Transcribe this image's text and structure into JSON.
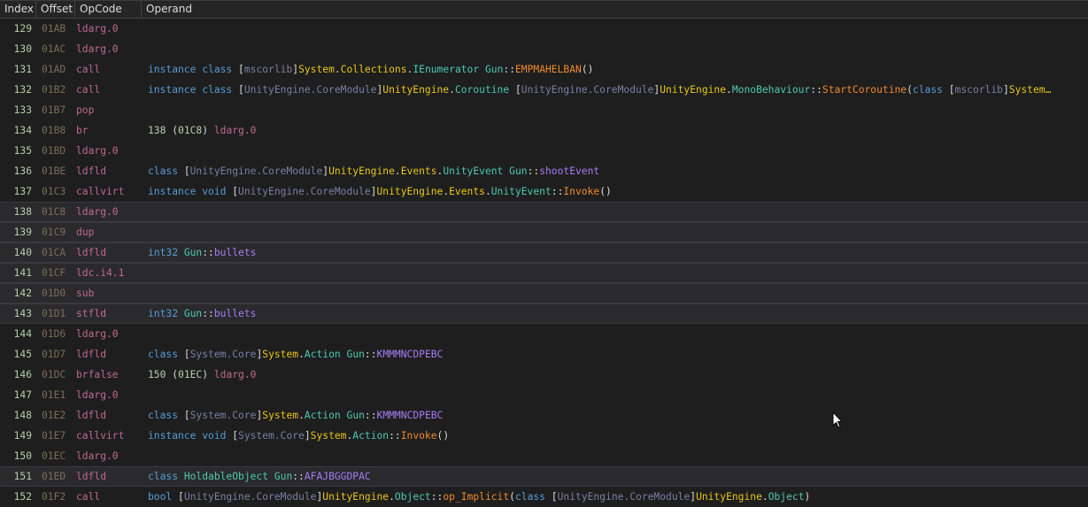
{
  "header": {
    "columns": [
      "Index",
      "Offset",
      "OpCode",
      "Operand"
    ]
  },
  "colors": {
    "keyword": "#569cd6",
    "assembly": "#7a7fa6",
    "namespace": "#e6c619",
    "type": "#4ec9b0",
    "method": "#f08a2c",
    "field": "#a77cf4",
    "opcode": "#c06a8e",
    "index": "#b5cea8",
    "offset": "#7a6e55",
    "background": "#1e1e1e",
    "selected_background": "#2a2a2d"
  },
  "rows": [
    {
      "index": "129",
      "offset": "01AB",
      "opcode": "ldarg.0",
      "selected": false,
      "operand": []
    },
    {
      "index": "130",
      "offset": "01AC",
      "opcode": "ldarg.0",
      "selected": false,
      "operand": []
    },
    {
      "index": "131",
      "offset": "01AD",
      "opcode": "call",
      "selected": false,
      "operand": [
        [
          "k",
          "instance class "
        ],
        [
          "p",
          "["
        ],
        [
          "a",
          "mscorlib"
        ],
        [
          "p",
          "]"
        ],
        [
          "n",
          "System"
        ],
        [
          "p",
          "."
        ],
        [
          "n",
          "Collections"
        ],
        [
          "p",
          "."
        ],
        [
          "t",
          "IEnumerator"
        ],
        [
          "p",
          " "
        ],
        [
          "t",
          "Gun"
        ],
        [
          "p",
          "::"
        ],
        [
          "m",
          "EMPMAHELBAN"
        ],
        [
          "p",
          "()"
        ]
      ]
    },
    {
      "index": "132",
      "offset": "01B2",
      "opcode": "call",
      "selected": false,
      "operand": [
        [
          "k",
          "instance class "
        ],
        [
          "p",
          "["
        ],
        [
          "a",
          "UnityEngine.CoreModule"
        ],
        [
          "p",
          "]"
        ],
        [
          "n",
          "UnityEngine"
        ],
        [
          "p",
          "."
        ],
        [
          "t",
          "Coroutine"
        ],
        [
          "p",
          " ["
        ],
        [
          "a",
          "UnityEngine.CoreModule"
        ],
        [
          "p",
          "]"
        ],
        [
          "n",
          "UnityEngine"
        ],
        [
          "p",
          "."
        ],
        [
          "t",
          "MonoBehaviour"
        ],
        [
          "p",
          "::"
        ],
        [
          "m",
          "StartCoroutine"
        ],
        [
          "p",
          "("
        ],
        [
          "k",
          "class "
        ],
        [
          "p",
          "["
        ],
        [
          "a",
          "mscorlib"
        ],
        [
          "p",
          "]"
        ],
        [
          "n",
          "System…"
        ]
      ]
    },
    {
      "index": "133",
      "offset": "01B7",
      "opcode": "pop",
      "selected": false,
      "operand": []
    },
    {
      "index": "134",
      "offset": "01B8",
      "opcode": "br",
      "selected": false,
      "operand": [
        [
          "num",
          "138"
        ],
        [
          "p",
          " ("
        ],
        [
          "num",
          "01C8"
        ],
        [
          "p",
          ") "
        ],
        [
          "op",
          "ldarg.0"
        ]
      ]
    },
    {
      "index": "135",
      "offset": "01BD",
      "opcode": "ldarg.0",
      "selected": false,
      "operand": []
    },
    {
      "index": "136",
      "offset": "01BE",
      "opcode": "ldfld",
      "selected": false,
      "operand": [
        [
          "k",
          "class "
        ],
        [
          "p",
          "["
        ],
        [
          "a",
          "UnityEngine.CoreModule"
        ],
        [
          "p",
          "]"
        ],
        [
          "n",
          "UnityEngine"
        ],
        [
          "p",
          "."
        ],
        [
          "n",
          "Events"
        ],
        [
          "p",
          "."
        ],
        [
          "t",
          "UnityEvent"
        ],
        [
          "p",
          " "
        ],
        [
          "t",
          "Gun"
        ],
        [
          "p",
          "::"
        ],
        [
          "f",
          "shootEvent"
        ]
      ]
    },
    {
      "index": "137",
      "offset": "01C3",
      "opcode": "callvirt",
      "selected": false,
      "operand": [
        [
          "k",
          "instance void "
        ],
        [
          "p",
          "["
        ],
        [
          "a",
          "UnityEngine.CoreModule"
        ],
        [
          "p",
          "]"
        ],
        [
          "n",
          "UnityEngine"
        ],
        [
          "p",
          "."
        ],
        [
          "n",
          "Events"
        ],
        [
          "p",
          "."
        ],
        [
          "t",
          "UnityEvent"
        ],
        [
          "p",
          "::"
        ],
        [
          "m",
          "Invoke"
        ],
        [
          "p",
          "()"
        ]
      ]
    },
    {
      "index": "138",
      "offset": "01C8",
      "opcode": "ldarg.0",
      "selected": true,
      "operand": []
    },
    {
      "index": "139",
      "offset": "01C9",
      "opcode": "dup",
      "selected": true,
      "operand": []
    },
    {
      "index": "140",
      "offset": "01CA",
      "opcode": "ldfld",
      "selected": true,
      "operand": [
        [
          "k",
          "int32 "
        ],
        [
          "t",
          "Gun"
        ],
        [
          "p",
          "::"
        ],
        [
          "f",
          "bullets"
        ]
      ]
    },
    {
      "index": "141",
      "offset": "01CF",
      "opcode": "ldc.i4.1",
      "selected": true,
      "operand": []
    },
    {
      "index": "142",
      "offset": "01D0",
      "opcode": "sub",
      "selected": true,
      "operand": []
    },
    {
      "index": "143",
      "offset": "01D1",
      "opcode": "stfld",
      "selected": true,
      "operand": [
        [
          "k",
          "int32 "
        ],
        [
          "t",
          "Gun"
        ],
        [
          "p",
          "::"
        ],
        [
          "f",
          "bullets"
        ]
      ]
    },
    {
      "index": "144",
      "offset": "01D6",
      "opcode": "ldarg.0",
      "selected": false,
      "operand": []
    },
    {
      "index": "145",
      "offset": "01D7",
      "opcode": "ldfld",
      "selected": false,
      "operand": [
        [
          "k",
          "class "
        ],
        [
          "p",
          "["
        ],
        [
          "a",
          "System.Core"
        ],
        [
          "p",
          "]"
        ],
        [
          "n",
          "System"
        ],
        [
          "p",
          "."
        ],
        [
          "t",
          "Action"
        ],
        [
          "p",
          " "
        ],
        [
          "t",
          "Gun"
        ],
        [
          "p",
          "::"
        ],
        [
          "f",
          "KMMMNCDPEBC"
        ]
      ]
    },
    {
      "index": "146",
      "offset": "01DC",
      "opcode": "brfalse",
      "selected": false,
      "operand": [
        [
          "num",
          "150"
        ],
        [
          "p",
          " ("
        ],
        [
          "num",
          "01EC"
        ],
        [
          "p",
          ") "
        ],
        [
          "op",
          "ldarg.0"
        ]
      ]
    },
    {
      "index": "147",
      "offset": "01E1",
      "opcode": "ldarg.0",
      "selected": false,
      "operand": []
    },
    {
      "index": "148",
      "offset": "01E2",
      "opcode": "ldfld",
      "selected": false,
      "operand": [
        [
          "k",
          "class "
        ],
        [
          "p",
          "["
        ],
        [
          "a",
          "System.Core"
        ],
        [
          "p",
          "]"
        ],
        [
          "n",
          "System"
        ],
        [
          "p",
          "."
        ],
        [
          "t",
          "Action"
        ],
        [
          "p",
          " "
        ],
        [
          "t",
          "Gun"
        ],
        [
          "p",
          "::"
        ],
        [
          "f",
          "KMMMNCDPEBC"
        ]
      ]
    },
    {
      "index": "149",
      "offset": "01E7",
      "opcode": "callvirt",
      "selected": false,
      "operand": [
        [
          "k",
          "instance void "
        ],
        [
          "p",
          "["
        ],
        [
          "a",
          "System.Core"
        ],
        [
          "p",
          "]"
        ],
        [
          "n",
          "System"
        ],
        [
          "p",
          "."
        ],
        [
          "t",
          "Action"
        ],
        [
          "p",
          "::"
        ],
        [
          "m",
          "Invoke"
        ],
        [
          "p",
          "()"
        ]
      ]
    },
    {
      "index": "150",
      "offset": "01EC",
      "opcode": "ldarg.0",
      "selected": false,
      "operand": []
    },
    {
      "index": "151",
      "offset": "01ED",
      "opcode": "ldfld",
      "selected": true,
      "operand": [
        [
          "k",
          "class "
        ],
        [
          "t",
          "HoldableObject"
        ],
        [
          "p",
          " "
        ],
        [
          "t",
          "Gun"
        ],
        [
          "p",
          "::"
        ],
        [
          "f",
          "AFAJBGGDPAC"
        ]
      ]
    },
    {
      "index": "152",
      "offset": "01F2",
      "opcode": "call",
      "selected": false,
      "operand": [
        [
          "k",
          "bool "
        ],
        [
          "p",
          "["
        ],
        [
          "a",
          "UnityEngine.CoreModule"
        ],
        [
          "p",
          "]"
        ],
        [
          "n",
          "UnityEngine"
        ],
        [
          "p",
          "."
        ],
        [
          "t",
          "Object"
        ],
        [
          "p",
          "::"
        ],
        [
          "m",
          "op_Implicit"
        ],
        [
          "p",
          "("
        ],
        [
          "k",
          "class "
        ],
        [
          "p",
          "["
        ],
        [
          "a",
          "UnityEngine.CoreModule"
        ],
        [
          "p",
          "]"
        ],
        [
          "n",
          "UnityEngine"
        ],
        [
          "p",
          "."
        ],
        [
          "t",
          "Object"
        ],
        [
          "p",
          ")"
        ]
      ]
    }
  ]
}
